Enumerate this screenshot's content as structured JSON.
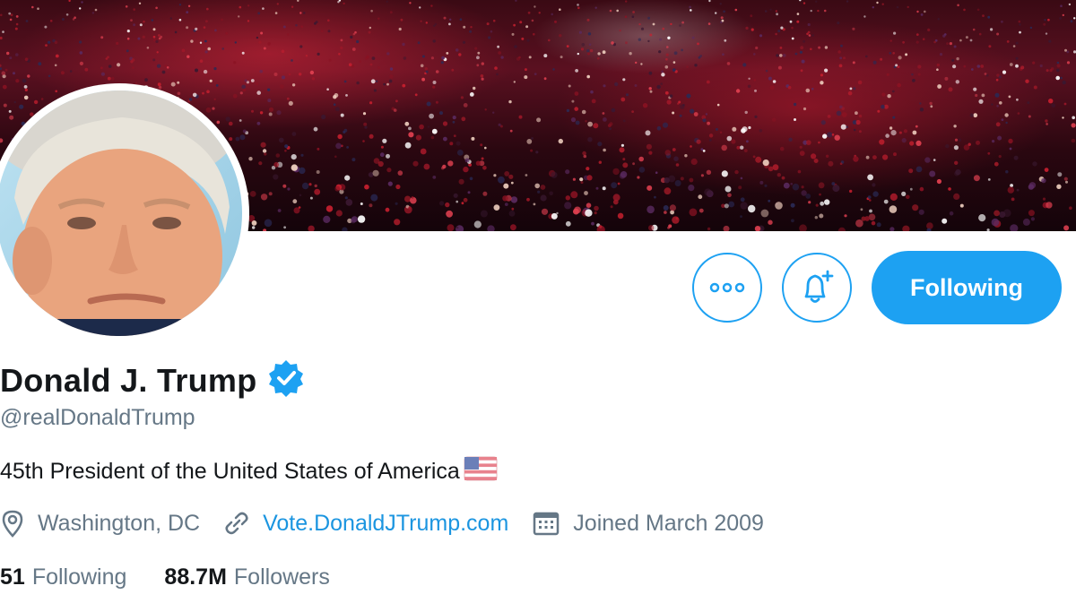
{
  "profile": {
    "name": "Donald J. Trump",
    "handle": "@realDonaldTrump",
    "bio": "45th President of the United States of America",
    "location": "Washington, DC",
    "website": "Vote.DonaldJTrump.com",
    "joined": "Joined March 2009"
  },
  "actions": {
    "follow_label": "Following"
  },
  "stats": {
    "following_count": "51",
    "following_label": "Following",
    "followers_count": "88.7M",
    "followers_label": "Followers"
  },
  "colors": {
    "accent": "#1da1f2",
    "link": "#1b95e0",
    "secondary_text": "#657786"
  },
  "icons": [
    "more-icon",
    "notification-bell-plus-icon",
    "verified-badge-icon",
    "us-flag-icon",
    "location-pin-icon",
    "link-icon",
    "calendar-icon"
  ]
}
